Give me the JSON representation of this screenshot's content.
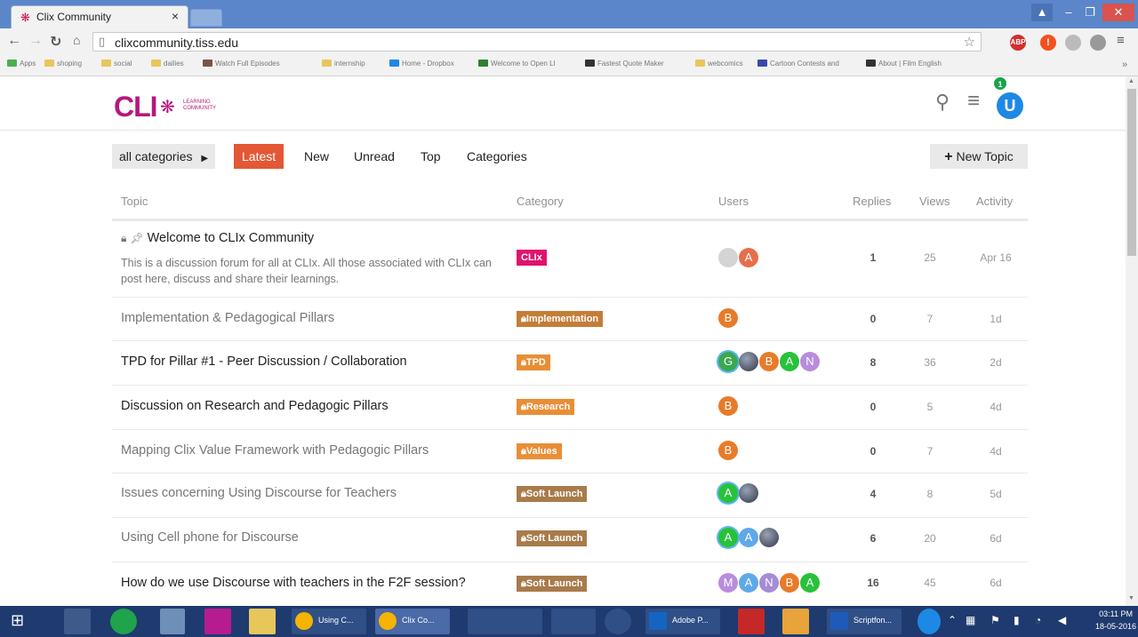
{
  "browser": {
    "tab_title": "Clix Community",
    "tab_close": "×",
    "url": "clixcommunity.tiss.edu",
    "bookmarks": [
      "Apps",
      "shoping",
      "social",
      "dailies",
      "Watch Full Episodes",
      "internship",
      "Home - Dropbox",
      "Welcome to Open LI",
      "Fastest Quote Maker",
      "webcomics",
      "Cartoon Contests and",
      "About | Film English"
    ],
    "extensions": [
      "ABP",
      "!"
    ]
  },
  "header": {
    "logo_text": "CLI",
    "logo_sub": "LEARNING COMMUNITY",
    "avatar_letter": "U",
    "notification_count": "1"
  },
  "nav": {
    "category_dropdown": "all categories",
    "pills": [
      "Latest",
      "New",
      "Unread",
      "Top",
      "Categories"
    ],
    "active": "Latest",
    "new_topic": "New Topic"
  },
  "table": {
    "headers": {
      "topic": "Topic",
      "category": "Category",
      "users": "Users",
      "replies": "Replies",
      "views": "Views",
      "activity": "Activity"
    },
    "rows": [
      {
        "title": "Welcome to CLIx Community",
        "excerpt": "This is a discussion forum for all at CLIx. All those associated with CLIx can post here, discuss and share their learnings.",
        "category": "CLIx",
        "users": [
          "",
          "A"
        ],
        "replies": "1",
        "views": "25",
        "activity": "Apr 16"
      },
      {
        "title": "Implementation & Pedagogical Pillars",
        "category": "Implementation",
        "users": [
          "B"
        ],
        "replies": "0",
        "views": "7",
        "activity": "1d"
      },
      {
        "title": "TPD for Pillar #1 - Peer Discussion / Collaboration",
        "category": "TPD",
        "users": [
          "G",
          "",
          "B",
          "A",
          "N"
        ],
        "replies": "8",
        "views": "36",
        "activity": "2d"
      },
      {
        "title": "Discussion on Research and Pedagogic Pillars",
        "category": "Research",
        "users": [
          "B"
        ],
        "replies": "0",
        "views": "5",
        "activity": "4d"
      },
      {
        "title": "Mapping Clix Value Framework with Pedagogic Pillars",
        "category": "Values",
        "users": [
          "B"
        ],
        "replies": "0",
        "views": "7",
        "activity": "4d"
      },
      {
        "title": "Issues concerning Using Discourse for Teachers",
        "category": "Soft Launch",
        "users": [
          "A",
          ""
        ],
        "replies": "4",
        "views": "8",
        "activity": "5d"
      },
      {
        "title": "Using Cell phone for Discourse",
        "category": "Soft Launch",
        "users": [
          "A",
          "A",
          ""
        ],
        "replies": "6",
        "views": "20",
        "activity": "6d"
      },
      {
        "title": "How do we use Discourse with teachers in the F2F session?",
        "category": "Soft Launch",
        "users": [
          "M",
          "A",
          "N",
          "B",
          "A"
        ],
        "replies": "16",
        "views": "45",
        "activity": "6d"
      }
    ]
  },
  "taskbar": {
    "labels": [
      "Using C...",
      "Clix Co...",
      "Adobe P...",
      "Scriptfon..."
    ],
    "time": "03:11 PM",
    "date": "18-05-2016"
  },
  "colors": {
    "accent": "#e45735",
    "clix_badge": "#e0136e",
    "cat_brown": "#c47d38",
    "cat_orange": "#e88e36",
    "soft_launch": "#a87b4b",
    "logo": "#b5187c"
  }
}
